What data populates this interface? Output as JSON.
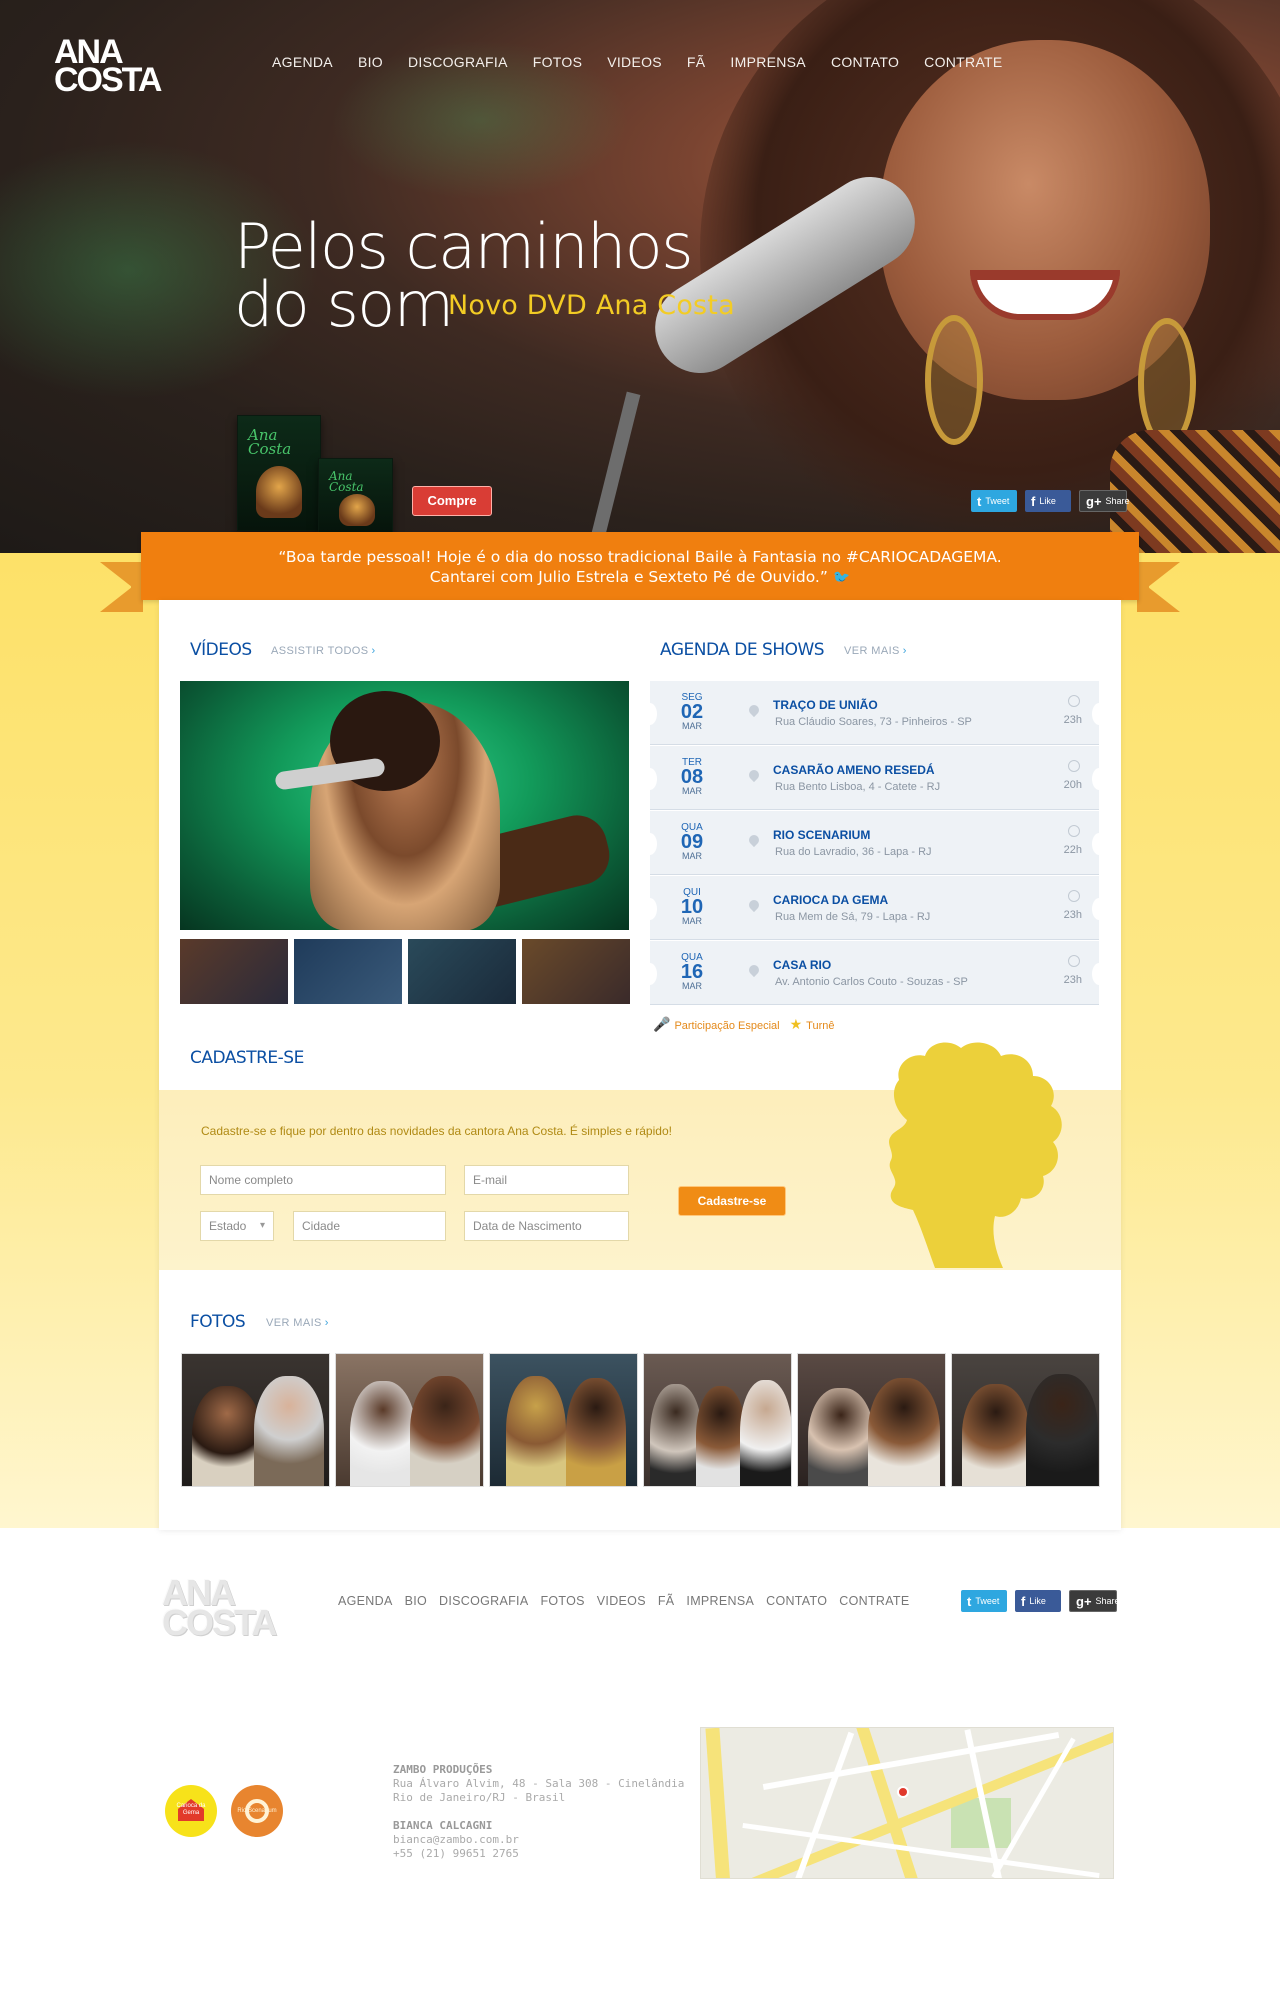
{
  "brand": {
    "logo_line1": "ANA",
    "logo_line2": "COSTA"
  },
  "nav": [
    "AGENDA",
    "BIO",
    "DISCOGRAFIA",
    "FOTOS",
    "VIDEOS",
    "FÃ",
    "IMPRENSA",
    "CONTATO",
    "CONTRATE"
  ],
  "hero": {
    "title_line1": "Pelos caminhos",
    "title_line2": "do som",
    "subtitle": "Novo DVD Ana Costa",
    "dvd_title_line1": "Ana",
    "dvd_title_line2": "Costa",
    "buy_button": "Compre"
  },
  "social": {
    "tweet": "Tweet",
    "like": "Like",
    "share": "Share"
  },
  "tweet_banner": {
    "line1": "“Boa tarde pessoal! Hoje é o dia do nosso tradicional Baile à Fantasia no  #CARIOCADAGEMA.",
    "line2": "Cantarei com Julio Estrela e Sexteto Pé de Ouvido.”"
  },
  "videos": {
    "title": "VÍDEOS",
    "link": "ASSISTIR TODOS"
  },
  "agenda": {
    "title": "AGENDA DE SHOWS",
    "link": "VER MAIS",
    "shows": [
      {
        "dow": "SEG",
        "day": "02",
        "month": "MAR",
        "venue": "TRAÇO DE UNIÃO",
        "address": "Rua Cláudio Soares, 73 - Pinheiros - SP",
        "time": "23h"
      },
      {
        "dow": "TER",
        "day": "08",
        "month": "MAR",
        "venue": "CASARÃO AMENO RESEDÁ",
        "address": "Rua Bento Lisboa, 4 - Catete - RJ",
        "time": "20h"
      },
      {
        "dow": "QUA",
        "day": "09",
        "month": "MAR",
        "venue": "RIO SCENARIUM",
        "address": "Rua do Lavradio, 36 - Lapa - RJ",
        "time": "22h"
      },
      {
        "dow": "QUI",
        "day": "10",
        "month": "MAR",
        "venue": "CARIOCA DA GEMA",
        "address": "Rua Mem de Sá, 79 - Lapa - RJ",
        "time": "23h"
      },
      {
        "dow": "QUA",
        "day": "16",
        "month": "MAR",
        "venue": "CASA RIO",
        "address": "Av. Antonio Carlos Couto - Souzas - SP",
        "time": "23h"
      }
    ],
    "legend_special": "Participação Especial",
    "legend_tour": "Turnê"
  },
  "signup": {
    "title": "CADASTRE-SE",
    "text": "Cadastre-se e fique por dentro das novidades da cantora Ana Costa. É simples e rápido!",
    "name_placeholder": "Nome completo",
    "email_placeholder": "E-mail",
    "state_placeholder": "Estado",
    "city_placeholder": "Cidade",
    "birth_placeholder": "Data de Nascimento",
    "button": "Cadastre-se"
  },
  "photos": {
    "title": "FOTOS",
    "link": "VER MAIS"
  },
  "footer": {
    "nav": [
      "AGENDA",
      "BIO",
      "DISCOGRAFIA",
      "FOTOS",
      "VIDEOS",
      "FÃ",
      "IMPRENSA",
      "CONTATO",
      "CONTRATE"
    ],
    "badge1_label": "Carioca da Gema",
    "badge2_label": "Rio Scenarium",
    "company": "ZAMBO PRODUÇÕES",
    "address1": "Rua Álvaro Alvim, 48 - Sala 308 - Cinelândia",
    "address2": "Rio de Janeiro/RJ - Brasil",
    "contact_name": "BIANCA CALCAGNI",
    "email": "bianca@zambo.com.br",
    "phone": "+55 (21) 99651 2765"
  },
  "colors": {
    "brand_blue": "#0b4fa3",
    "ribbon_orange": "#f07f0f",
    "accent_yellow": "#f3cc24",
    "buy_red": "#d93d35"
  }
}
